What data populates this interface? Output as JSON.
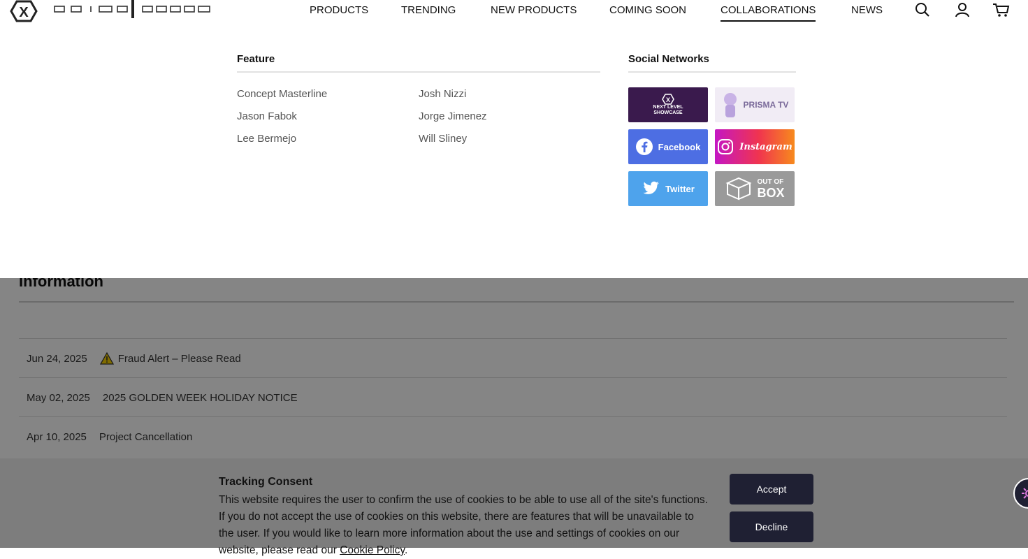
{
  "brand": {
    "name": "PRIME 1 STUDIO"
  },
  "nav": {
    "items": [
      "PRODUCTS",
      "TRENDING",
      "NEW PRODUCTS",
      "COMING SOON",
      "COLLABORATIONS",
      "NEWS"
    ],
    "active": "COLLABORATIONS"
  },
  "header_icons": [
    "search-icon",
    "user-icon",
    "cart-icon"
  ],
  "mega_menu": {
    "feature_title": "Feature",
    "feature_links": [
      "Concept Masterline",
      "Jason Fabok",
      "Lee Bermejo",
      "Josh Nizzi",
      "Jorge Jimenez",
      "Will Sliney"
    ],
    "social_title": "Social Networks",
    "social_tiles": {
      "showcase": "NEXT LEVEL SHOWCASE",
      "prisma": "PRISMA TV",
      "facebook": "Facebook",
      "instagram": "Instagram",
      "twitter": "Twitter",
      "outofbox_1": "OUT OF",
      "outofbox_2": "BOX"
    }
  },
  "info": {
    "title": "Information",
    "news": [
      {
        "date": "Jun 24, 2025",
        "title": "Fraud Alert – Please Read",
        "warning": true
      },
      {
        "date": "May 02, 2025",
        "title": "2025 GOLDEN WEEK HOLIDAY NOTICE",
        "warning": false
      },
      {
        "date": "Apr 10, 2025",
        "title": "Project Cancellation",
        "warning": false
      }
    ]
  },
  "consent": {
    "title": "Tracking Consent",
    "body": "This website requires the user to confirm the use of cookies to be able to use all of the site's functions. If you do not accept the use of cookies on this website, there are features that will be unavailable to the user. If you would like to learn more information about the use and settings of cookies on our website, please read our ",
    "policy_link": "Cookie Policy",
    "body_end": ".",
    "accept": "Accept",
    "decline": "Decline"
  },
  "colors": {
    "button_bg": "#1f2033",
    "facebook": "#4d6ee3",
    "twitter": "#4ea3ec",
    "outofbox": "#9a9a9a",
    "showcase": "#3a1a4d"
  }
}
